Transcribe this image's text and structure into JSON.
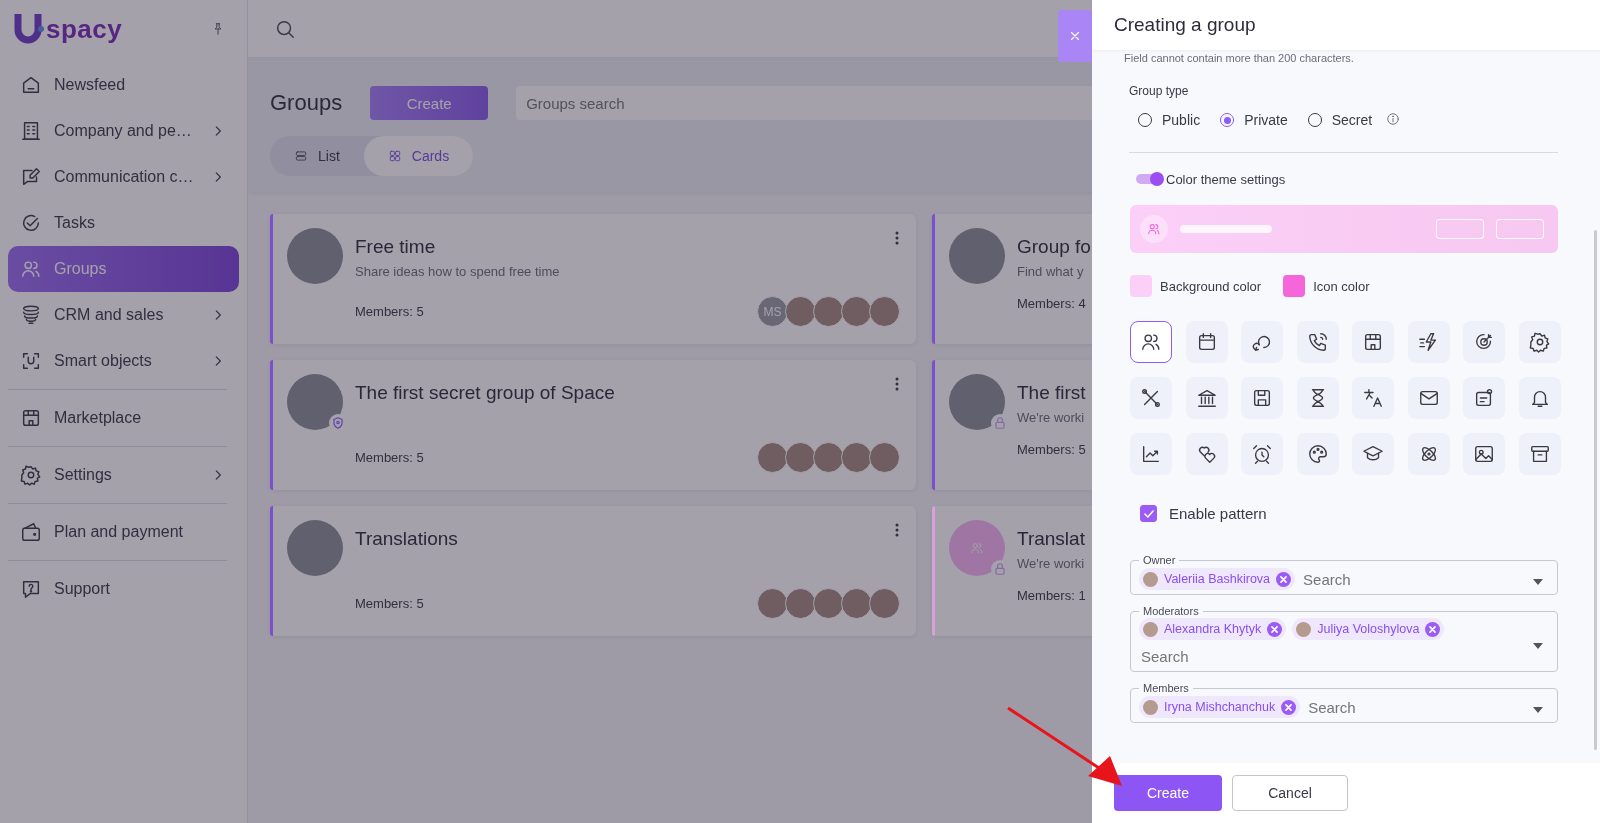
{
  "sidebar": {
    "logo": "spacy",
    "sections": [
      [
        {
          "label": "Newsfeed",
          "expandable": false,
          "selected": false
        },
        {
          "label": "Company and pe…",
          "expandable": true,
          "selected": false
        },
        {
          "label": "Communication c…",
          "expandable": true,
          "selected": false
        },
        {
          "label": "Tasks",
          "expandable": false,
          "selected": false
        },
        {
          "label": "Groups",
          "expandable": false,
          "selected": true
        },
        {
          "label": "CRM and sales",
          "expandable": true,
          "selected": false
        },
        {
          "label": "Smart objects",
          "expandable": true,
          "selected": false
        }
      ],
      [
        {
          "label": "Marketplace",
          "expandable": false,
          "selected": false
        }
      ],
      [
        {
          "label": "Settings",
          "expandable": true,
          "selected": false
        }
      ],
      [
        {
          "label": "Plan and payment",
          "expandable": false,
          "selected": false
        }
      ],
      [
        {
          "label": "Support",
          "expandable": false,
          "selected": false
        }
      ]
    ]
  },
  "main": {
    "title": "Groups",
    "create_button": "Create",
    "search": {
      "placeholder": "Groups search"
    },
    "views": [
      {
        "label": "List",
        "selected": false
      },
      {
        "label": "Cards",
        "selected": true
      }
    ],
    "cards": [
      {
        "title": "Free time",
        "description": "Share ideas how to spend free time",
        "members": "Members: 5",
        "color": "#7a50cc",
        "cover": {
          "kind": "photo"
        },
        "avatars": [
          {
            "kind": "initials",
            "text": "MS"
          },
          {
            "kind": "photo"
          },
          {
            "kind": "photo"
          },
          {
            "kind": "photo"
          },
          {
            "kind": "photo"
          }
        ]
      },
      {
        "title": "Group fo",
        "description": "Find what y",
        "members": "Members: 4",
        "color": "#7a50cc",
        "cover": {
          "kind": "photo"
        }
      },
      {
        "title": "The first secret group of Space",
        "members": "Members: 5",
        "color": "#7a50cc",
        "cover": {
          "kind": "photo"
        },
        "badge": {
          "kind": "secret"
        },
        "avatars": [
          {
            "kind": "photo"
          },
          {
            "kind": "photo"
          },
          {
            "kind": "photo"
          },
          {
            "kind": "photo"
          },
          {
            "kind": "photo"
          }
        ]
      },
      {
        "title": "The first",
        "description": "We're worki",
        "members": "Members: 5",
        "color": "#7a50cc",
        "cover": {
          "kind": "photo"
        },
        "badge": {
          "kind": "private"
        }
      },
      {
        "title": "Translations",
        "members": "Members: 5",
        "color": "#7a50cc",
        "cover": {
          "kind": "photo"
        },
        "avatars": [
          {
            "kind": "photo"
          },
          {
            "kind": "photo"
          },
          {
            "kind": "photo"
          },
          {
            "kind": "photo"
          },
          {
            "kind": "photo"
          }
        ]
      },
      {
        "title": "Translat",
        "description": "We're worki",
        "members": "Members: 1",
        "color": "#d9a0dc",
        "cover": {
          "kind": "icon"
        },
        "badge": {
          "kind": "private"
        }
      }
    ]
  },
  "panel": {
    "title": "Creating a group",
    "hint": "Field cannot contain more than 200 characters.",
    "group_type": {
      "label": "Group type",
      "options": [
        {
          "label": "Public",
          "selected": false,
          "info_icon": false
        },
        {
          "label": "Private",
          "selected": true,
          "info_icon": false
        },
        {
          "label": "Secret",
          "selected": false,
          "info_icon": true
        }
      ]
    },
    "color_theme": {
      "label": "Color theme settings",
      "on": true
    },
    "color_pickers": [
      {
        "label": "Background color",
        "color": "#fbcff7"
      },
      {
        "label": "Icon color",
        "color": "#f466da"
      }
    ],
    "icons": [
      {
        "selected": true
      },
      {
        "selected": false
      },
      {
        "selected": false
      },
      {
        "selected": false
      },
      {
        "selected": false
      },
      {
        "selected": false
      },
      {
        "selected": false
      },
      {
        "selected": false
      },
      {
        "selected": false
      },
      {
        "selected": false
      },
      {
        "selected": false
      },
      {
        "selected": false
      },
      {
        "selected": false
      },
      {
        "selected": false
      },
      {
        "selected": false
      },
      {
        "selected": false
      },
      {
        "selected": false
      },
      {
        "selected": false
      },
      {
        "selected": false
      },
      {
        "selected": false
      },
      {
        "selected": false
      },
      {
        "selected": false
      },
      {
        "selected": false
      },
      {
        "selected": false
      }
    ],
    "pattern": {
      "label": "Enable pattern",
      "checked": true
    },
    "fields": [
      {
        "label": "Owner",
        "chips": [
          "Valeriia Bashkirova"
        ],
        "placeholder": "Search"
      },
      {
        "label": "Moderators",
        "chips": [
          "Alexandra Khytyk",
          "Juliya Voloshylova"
        ],
        "placeholder": "Search"
      },
      {
        "label": "Members",
        "chips": [
          "Iryna Mishchanchuk"
        ],
        "placeholder": "Search"
      }
    ],
    "buttons": [
      {
        "label": "Create",
        "kind": "primary"
      },
      {
        "label": "Cancel",
        "kind": "secondary"
      }
    ]
  }
}
